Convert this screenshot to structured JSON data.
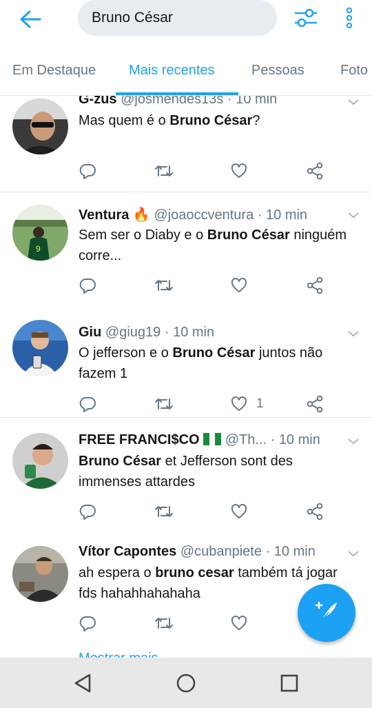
{
  "search": {
    "query": "Bruno César"
  },
  "tabs": [
    {
      "label": "Em Destaque"
    },
    {
      "label": "Mais recentes"
    },
    {
      "label": "Pessoas"
    },
    {
      "label": "Foto"
    }
  ],
  "tweets": [
    {
      "name": "G-zus",
      "handle": "@josmendes13s",
      "dot": "·",
      "time": "10 min",
      "text_parts": [
        "Mas quem é o ",
        "Bruno César",
        "?"
      ],
      "likes": ""
    },
    {
      "name": "Ventura",
      "emoji": "🔥",
      "handle": "@joaoccventura",
      "dot": "·",
      "time": "10 min",
      "text_parts": [
        "Sem ser o Diaby e o ",
        "Bruno César",
        " ninguém corre..."
      ],
      "likes": ""
    },
    {
      "name": "Giu",
      "handle": "@giug19",
      "dot": "·",
      "time": "10 min",
      "text_parts": [
        "O jefferson e o ",
        "Bruno César",
        " juntos não fazem 1"
      ],
      "likes": "1"
    },
    {
      "name": "FREE FRANCI$CO",
      "flag": "Nigeria flag",
      "handle": "@Th...",
      "dot": "·",
      "time": "10 min",
      "text_parts": [
        "",
        "Bruno César",
        " et Jefferson sont des immenses attardes"
      ],
      "likes": ""
    },
    {
      "name": "Vítor Capontes",
      "handle": "@cubanpiete",
      "dot": "·",
      "time": "10 min",
      "text_parts": [
        "ah espera o ",
        "bruno cesar",
        " também tá jogar fds hahahhahahaha"
      ],
      "likes": ""
    }
  ],
  "peek_text": "Mostrar mais",
  "colors": {
    "accent": "#1da1f2",
    "text": "#14171a",
    "secondary": "#657786",
    "divider": "#e1e8ed",
    "nav_bar": "#e8e8e8"
  },
  "icons": [
    "back-arrow-icon",
    "filter-sliders-icon",
    "more-vertical-icon",
    "reply-icon",
    "retweet-icon",
    "like-icon",
    "share-icon",
    "caret-down-icon",
    "compose-tweet-icon",
    "nav-back-icon",
    "nav-home-icon",
    "nav-recents-icon"
  ]
}
